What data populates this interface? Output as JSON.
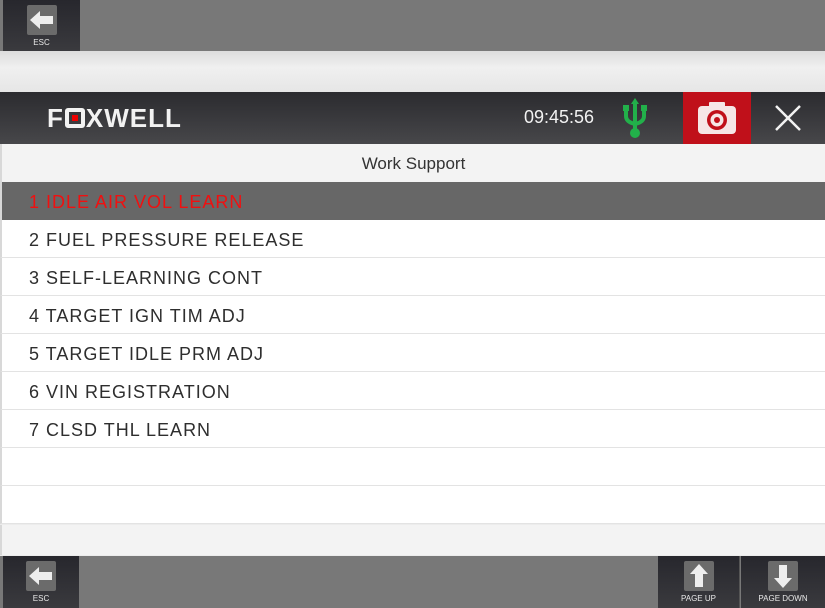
{
  "top_toolbar": {
    "esc_label": "ESC"
  },
  "header": {
    "brand": {
      "pre": "F",
      "post": "XWELL"
    },
    "clock": "09:45:56",
    "colors": {
      "usb": "#22b04a",
      "camera_bg": "#c0101a"
    }
  },
  "page_title": "Work Support",
  "menu": {
    "items": [
      {
        "label": "1 IDLE AIR VOL LEARN",
        "selected": true
      },
      {
        "label": "2 FUEL PRESSURE RELEASE",
        "selected": false
      },
      {
        "label": "3 SELF-LEARNING CONT",
        "selected": false
      },
      {
        "label": "4 TARGET IGN TIM ADJ",
        "selected": false
      },
      {
        "label": "5 TARGET IDLE PRM ADJ",
        "selected": false
      },
      {
        "label": "6 VIN REGISTRATION",
        "selected": false
      },
      {
        "label": "7 CLSD THL LEARN",
        "selected": false
      }
    ],
    "selected_color": "#f01010"
  },
  "bottom_toolbar": {
    "esc_label": "ESC",
    "page_up_label": "PAGE UP",
    "page_down_label": "PAGE DOWN"
  }
}
